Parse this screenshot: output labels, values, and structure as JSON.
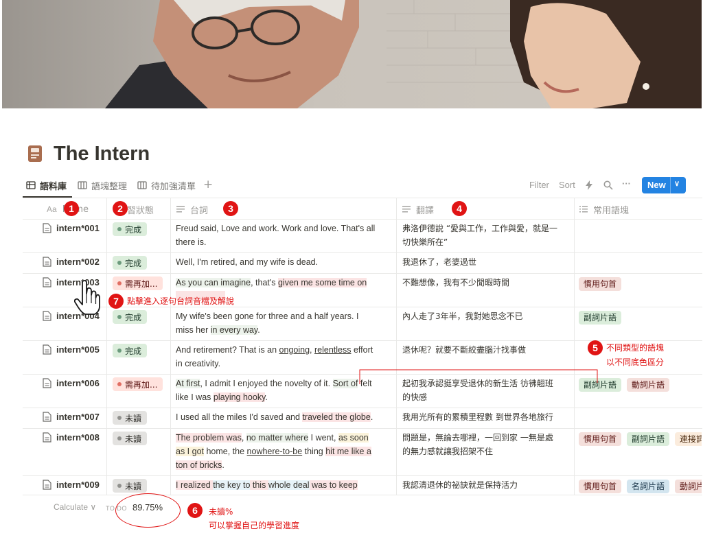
{
  "page": {
    "title": "The Intern",
    "icon": "journal-icon"
  },
  "views": {
    "tabs": [
      {
        "label": "語料庫",
        "icon": "table-icon",
        "active": true
      },
      {
        "label": "語塊整理",
        "icon": "board-icon",
        "active": false
      },
      {
        "label": "待加強清單",
        "icon": "board-icon",
        "active": false
      }
    ],
    "add_icon": "+"
  },
  "toolbar": {
    "filter": "Filter",
    "sort": "Sort",
    "automation_icon": "lightning-icon",
    "search_icon": "search-icon",
    "more": "···",
    "new": "New",
    "new_menu_icon": "chevron-down-icon"
  },
  "columns": {
    "name": {
      "prefix": "Aa",
      "label": "Name"
    },
    "status": {
      "label": "學習狀態"
    },
    "line": {
      "label": "台詞"
    },
    "translation": {
      "label": "翻譯"
    },
    "chunks": {
      "label": "常用語塊"
    }
  },
  "rows": [
    {
      "name": "intern*001",
      "status": "完成",
      "translation": [
        "弗洛伊德說 “愛與工作，工作與愛，就是一",
        "切快樂所在”"
      ],
      "tags": []
    },
    {
      "name": "intern*002",
      "status": "完成",
      "translation": [
        "我退休了，老婆過世"
      ],
      "tags": []
    },
    {
      "name": "intern*003",
      "status": "需再加...",
      "translation": [
        "不難想像，我有不少閒暇時間"
      ],
      "tags": [
        "慣用句首"
      ]
    },
    {
      "name": "intern*004",
      "status": "完成",
      "translation": [
        "內人走了3年半，我對她思念不已"
      ],
      "tags": [
        "副詞片語"
      ]
    },
    {
      "name": "intern*005",
      "status": "完成",
      "translation": [
        "退休呢？就要不斷絞盡腦汁找事做"
      ],
      "tags": []
    },
    {
      "name": "intern*006",
      "status": "需再加...",
      "translation": [
        "起初我承認挺享受退休的新生活 彷彿翹班",
        "的快感"
      ],
      "tags": [
        "副詞片語",
        "動詞片語"
      ]
    },
    {
      "name": "intern*007",
      "status": "未讀",
      "translation": [
        "我用光所有的累積里程數 到世界各地旅行"
      ],
      "tags": []
    },
    {
      "name": "intern*008",
      "status": "未讀",
      "translation": [
        "問題是，無論去哪裡，一回到家 一無是處",
        "的無力感就讓我招架不住"
      ],
      "tags": [
        "慣用句首",
        "副詞片語",
        "連接詞"
      ]
    },
    {
      "name": "intern*009",
      "status": "未讀",
      "translation": [
        "我認清退休的祕訣就是保持活力"
      ],
      "tags": [
        "慣用句首",
        "名詞片語",
        "動詞片語"
      ]
    }
  ],
  "lines": {
    "r1a": "Freud said, Love and work. Work and love. That's all",
    "r1b": "there is.",
    "r2a": "Well, I'm retired, and my wife is dead.",
    "r3a1": "As you can imagine",
    "r3a2": ", that's ",
    "r3a3": "given me some time on",
    "r4a1": "My wife's been gone for three and a half years. I",
    "r4b1": "miss her ",
    "r4b2": "in every way",
    "r4b3": ".",
    "r5a1": "And retirement? That is an ",
    "r5a2": "ongoing",
    "r5a3": ", ",
    "r5a4": "relentless",
    "r5a5": " effort",
    "r5b": "in creativity.",
    "r6a1": "At first",
    "r6a2": ", I admit I enjoyed the novelty of it. ",
    "r6a3": "Sort of",
    "r6a4": " felt",
    "r6b1": "like I was ",
    "r6b2": "playing hooky",
    "r6b3": ".",
    "r7a1": "I used all the miles I'd saved and ",
    "r7a2": "traveled the globe",
    "r7a3": ".",
    "r8a1": "The problem was",
    "r8a2": ", ",
    "r8a3": "no matter where",
    "r8a4": " I went, ",
    "r8a5": "as soon",
    "r8b1": "as I got",
    "r8b2": " home, the ",
    "r8b3": "nowhere-to-be",
    "r8b4": " thing ",
    "r8b5": "hit me like a",
    "r8c1": "ton of bricks",
    "r8c2": ".",
    "r9a1": "I realized ",
    "r9a2": "the key to",
    "r9a3": " this ",
    "r9a4": "whole deal",
    "r9a5": " was to ",
    "r9a6": "keep"
  },
  "footer": {
    "calculate": "Calculate ∨",
    "todo_label": "TO DO",
    "todo_value": "89.75%"
  },
  "annotations": {
    "b1": "1",
    "b2": "2",
    "b3": "3",
    "b4": "4",
    "b5": "5",
    "n5a": "不同類型的語塊",
    "n5b": "以不同底色區分",
    "b6": "6",
    "n6a": "未讀%",
    "n6b": "可以掌握自己的學習進度",
    "b7": "7",
    "n7": "點擊進入逐句台詞音檔及解說"
  },
  "colors": {
    "accent": "#2383e2",
    "annotation": "#e01414",
    "done": "#dbeddb",
    "need": "#ffe2dd",
    "unread": "#e3e2e0"
  }
}
